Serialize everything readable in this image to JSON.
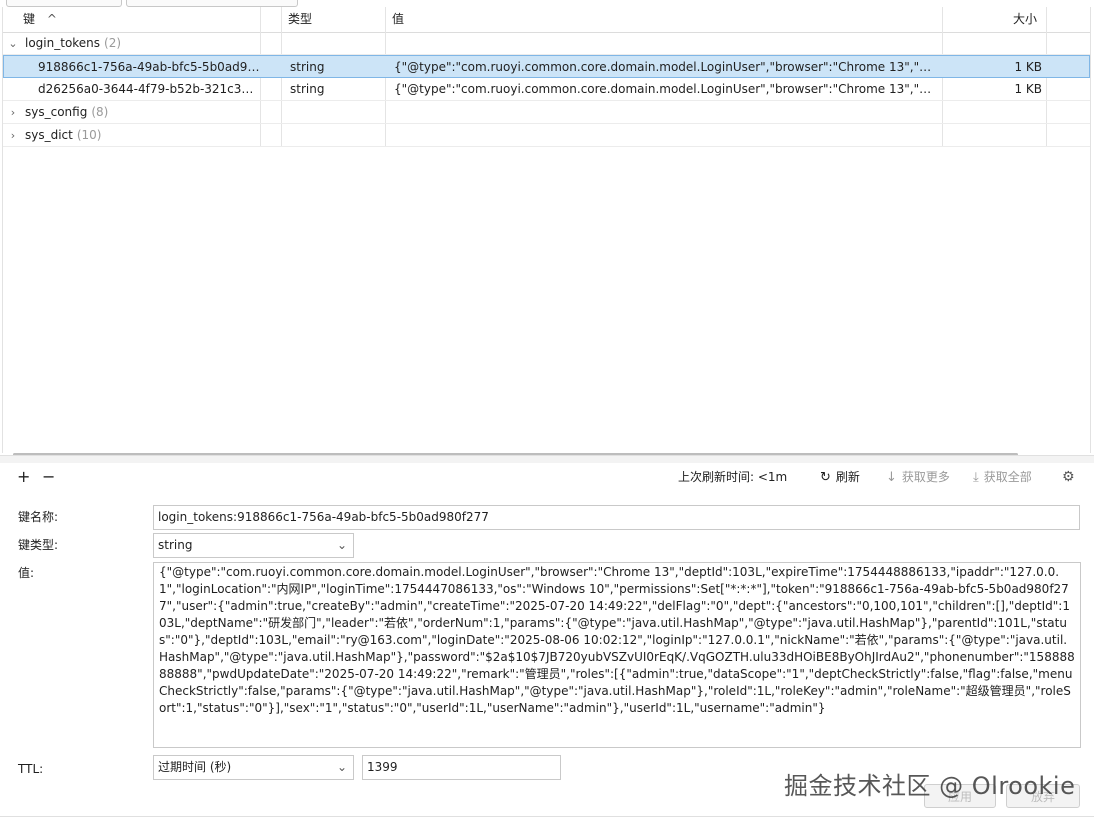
{
  "columns": {
    "key": "键",
    "type": "类型",
    "value": "值",
    "size": "大小"
  },
  "tree": [
    {
      "name": "login_tokens",
      "count": "(2)",
      "expanded": true
    },
    {
      "name": "sys_config",
      "count": "(8)",
      "expanded": false
    },
    {
      "name": "sys_dict",
      "count": "(10)",
      "expanded": false
    }
  ],
  "rows": [
    {
      "key": "918866c1-756a-49ab-bfc5-5b0ad98...",
      "type": "string",
      "value": "{\"@type\":\"com.ruoyi.common.core.domain.model.LoginUser\",\"browser\":\"Chrome 13\",\"deptI...",
      "size": "1 KB",
      "selected": true
    },
    {
      "key": "d26256a0-3644-4f79-b52b-321c3d0...",
      "type": "string",
      "value": "{\"@type\":\"com.ruoyi.common.core.domain.model.LoginUser\",\"browser\":\"Chrome 13\",\"deptI...",
      "size": "1 KB",
      "selected": false
    }
  ],
  "toolbar": {
    "add": "+",
    "remove": "−",
    "last_refresh": "上次刷新时间: <1m",
    "refresh": "刷新",
    "fetch_more": "获取更多",
    "fetch_all": "获取全部"
  },
  "form": {
    "key_name_label": "键名称:",
    "key_name": "login_tokens:918866c1-756a-49ab-bfc5-5b0ad980f277",
    "key_type_label": "键类型:",
    "key_type": "string",
    "value_label": "值:",
    "value": "{\"@type\":\"com.ruoyi.common.core.domain.model.LoginUser\",\"browser\":\"Chrome 13\",\"deptId\":103L,\"expireTime\":1754448886133,\"ipaddr\":\"127.0.0.1\",\"loginLocation\":\"内网IP\",\"loginTime\":1754447086133,\"os\":\"Windows 10\",\"permissions\":Set[\"*:*:*\"],\"token\":\"918866c1-756a-49ab-bfc5-5b0ad980f277\",\"user\":{\"admin\":true,\"createBy\":\"admin\",\"createTime\":\"2025-07-20 14:49:22\",\"delFlag\":\"0\",\"dept\":{\"ancestors\":\"0,100,101\",\"children\":[],\"deptId\":103L,\"deptName\":\"研发部门\",\"leader\":\"若依\",\"orderNum\":1,\"params\":{\"@type\":\"java.util.HashMap\",\"@type\":\"java.util.HashMap\"},\"parentId\":101L,\"status\":\"0\"},\"deptId\":103L,\"email\":\"ry@163.com\",\"loginDate\":\"2025-08-06 10:02:12\",\"loginIp\":\"127.0.0.1\",\"nickName\":\"若依\",\"params\":{\"@type\":\"java.util.HashMap\",\"@type\":\"java.util.HashMap\"},\"password\":\"$2a$10$7JB720yubVSZvUI0rEqK/.VqGOZTH.ulu33dHOiBE8ByOhJIrdAu2\",\"phonenumber\":\"15888888888\",\"pwdUpdateDate\":\"2025-07-20 14:49:22\",\"remark\":\"管理员\",\"roles\":[{\"admin\":true,\"dataScope\":\"1\",\"deptCheckStrictly\":false,\"flag\":false,\"menuCheckStrictly\":false,\"params\":{\"@type\":\"java.util.HashMap\",\"@type\":\"java.util.HashMap\"},\"roleId\":1L,\"roleKey\":\"admin\",\"roleName\":\"超级管理员\",\"roleSort\":1,\"status\":\"0\"}],\"sex\":\"1\",\"status\":\"0\",\"userId\":1L,\"userName\":\"admin\"},\"userId\":1L,\"username\":\"admin\"}",
    "ttl_label": "TTL:",
    "ttl_unit": "过期时间 (秒)",
    "ttl_value": "1399",
    "apply": "应用",
    "discard": "放弃"
  },
  "watermark": "掘金技术社区 @ Olrookie"
}
